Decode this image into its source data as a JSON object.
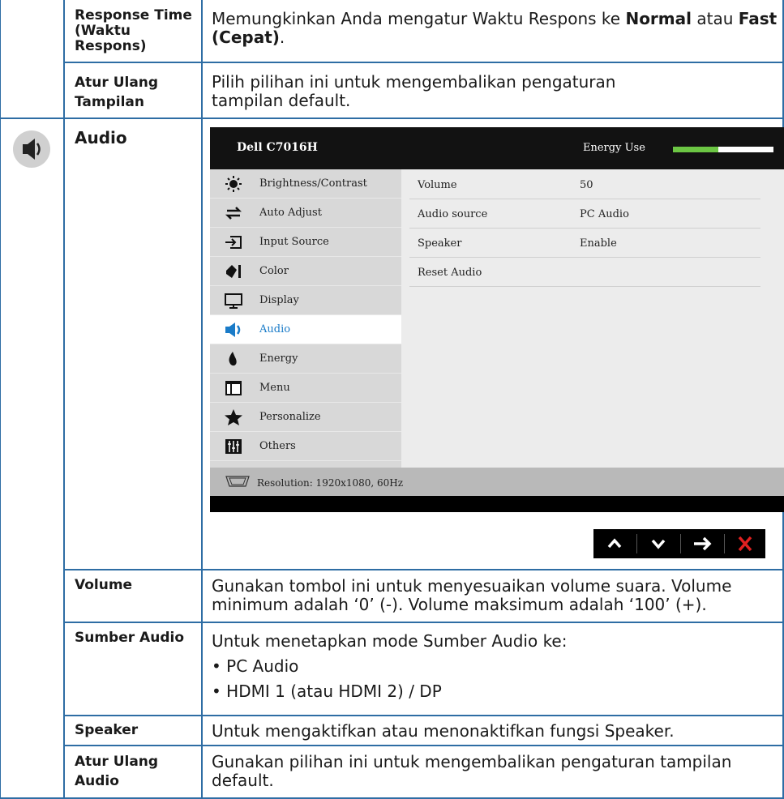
{
  "rows": {
    "response_time": {
      "label": "Response Time (Waktu Respons)",
      "desc_pre": "Memungkinkan Anda mengatur Waktu Respons ke ",
      "desc_bold1": "Normal",
      "desc_mid": " atau ",
      "desc_bold2": "Fast (Cepat)",
      "desc_post": "."
    },
    "reset_display": {
      "label": "Atur Ulang Tampilan",
      "desc": "Pilih pilihan ini untuk mengembalikan pengaturan tampilan default."
    },
    "audio": {
      "label": "Audio",
      "icon": "speaker-icon"
    },
    "volume": {
      "label": "Volume",
      "desc": "Gunakan tombol ini untuk menyesuaikan volume suara. Volume minimum adalah ‘0’ (-). Volume maksimum adalah ‘100’ (+)."
    },
    "audio_source": {
      "label": "Sumber Audio",
      "desc": "Untuk menetapkan mode Sumber Audio ke:",
      "bullets": [
        "• PC Audio",
        "• HDMI 1 (atau HDMI 2) / DP"
      ]
    },
    "speaker": {
      "label": "Speaker",
      "desc": "Untuk mengaktifkan atau menonaktifkan fungsi Speaker."
    },
    "reset_audio": {
      "label": "Atur Ulang Audio",
      "desc": "Gunakan pilihan ini untuk mengembalikan pengaturan tampilan default."
    }
  },
  "osd": {
    "title": "Dell C7016H",
    "energy_label": "Energy Use",
    "energy_level": 0.45,
    "colors": {
      "energy": "#6cc644",
      "active_text": "#1a7bc8",
      "close": "#e02020"
    },
    "menu": [
      {
        "label": "Brightness/Contrast",
        "icon": "brightness-icon"
      },
      {
        "label": "Auto Adjust",
        "icon": "auto-adjust-icon"
      },
      {
        "label": "Input Source",
        "icon": "input-source-icon"
      },
      {
        "label": "Color",
        "icon": "color-icon"
      },
      {
        "label": "Display",
        "icon": "display-icon"
      },
      {
        "label": "Audio",
        "icon": "audio-icon",
        "active": true
      },
      {
        "label": "Energy",
        "icon": "energy-icon"
      },
      {
        "label": "Menu",
        "icon": "menu-icon"
      },
      {
        "label": "Personalize",
        "icon": "star-icon"
      },
      {
        "label": "Others",
        "icon": "others-icon"
      }
    ],
    "settings": [
      {
        "name": "Volume",
        "value": "50"
      },
      {
        "name": "Audio source",
        "value": "PC Audio"
      },
      {
        "name": "Speaker",
        "value": "Enable"
      },
      {
        "name": "Reset Audio",
        "value": ""
      }
    ],
    "resolution": "Resolution: 1920x1080, 60Hz",
    "nav_buttons": [
      "up-icon",
      "down-icon",
      "right-arrow-icon",
      "close-icon"
    ]
  }
}
